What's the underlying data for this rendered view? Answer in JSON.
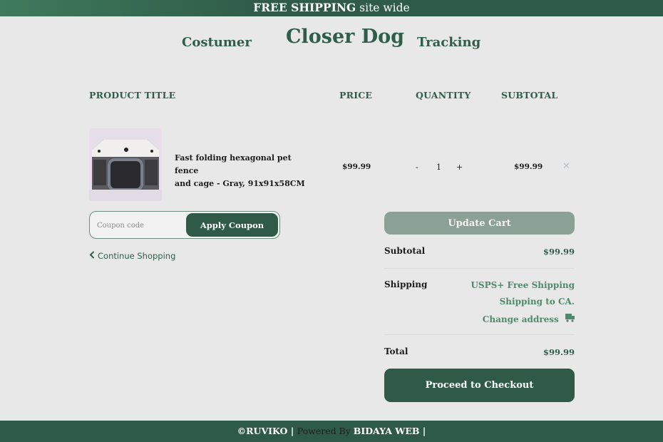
{
  "topbar": {
    "bold": "FREE SHIPPING",
    "rest": " site wide"
  },
  "nav": {
    "left": "Costumer",
    "brand": "Closer Dog",
    "right": "Tracking"
  },
  "table": {
    "headers": [
      "PRODUCT TITLE",
      "PRICE",
      "QUANTITY",
      "SUBTOTAL"
    ],
    "rows": [
      {
        "name_line1": "Fast folding hexagonal pet fence",
        "name_line2": "and cage - Gray, 91x91x58CM",
        "price": "$99.99",
        "qty_minus": "-",
        "qty": "1",
        "qty_plus": "+",
        "subtotal": "$99.99",
        "remove": "✕"
      }
    ]
  },
  "coupon": {
    "placeholder": "Coupon code",
    "button": "Apply Coupon"
  },
  "continue_shopping": "Continue Shopping",
  "cart": {
    "update_button": "Update Cart",
    "subtotal_label": "Subtotal",
    "subtotal_value": "$99.99",
    "shipping_label": "Shipping",
    "shipping_method": "USPS+ Free Shipping",
    "shipping_to": "Shipping to CA.",
    "change_address": "Change address",
    "total_label": "Total",
    "total_value": "$99.99",
    "checkout_button": "Proceed to Checkout"
  },
  "footer": {
    "copyright": "©RUVIKO",
    "sep1": " | ",
    "powered": "Powered By ",
    "company": "BIDAYA WEB",
    "sep2": " |"
  },
  "colors": {
    "brand_green": "#2f5a48",
    "accent_green": "#4f8a6c",
    "muted_button": "#8ba196"
  }
}
